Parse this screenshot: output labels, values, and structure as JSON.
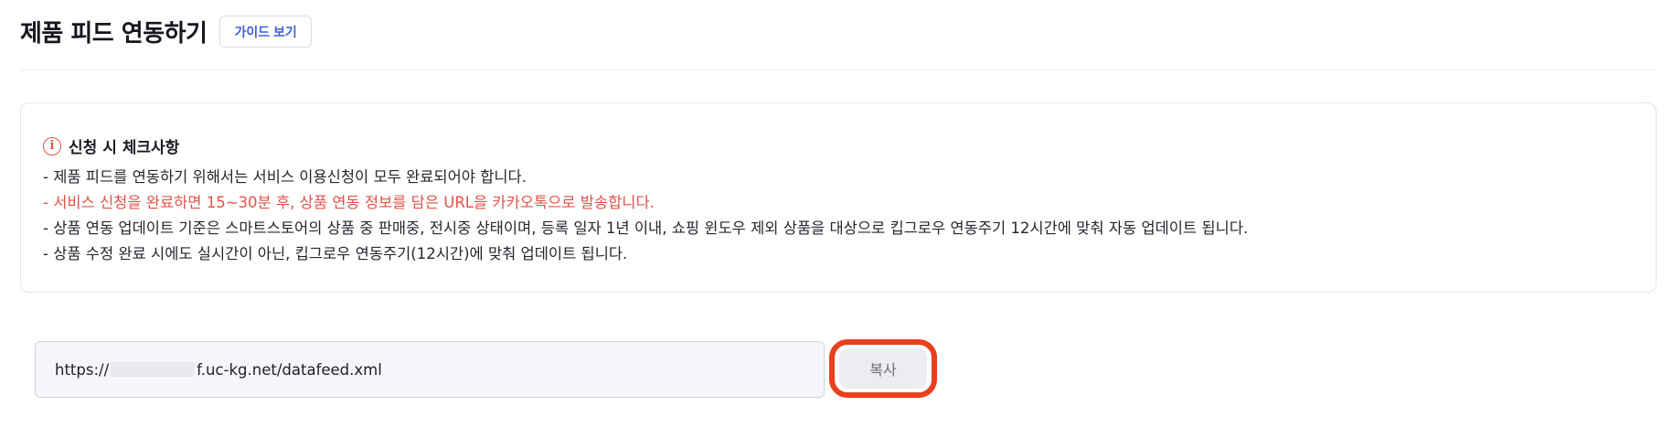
{
  "header": {
    "title": "제품 피드 연동하기",
    "guide_button": "가이드 보기"
  },
  "notice": {
    "icon": "info-circle-icon",
    "title": "신청 시 체크사항",
    "lines": [
      "- 제품 피드를 연동하기 위해서는 서비스 이용신청이 모두 완료되어야 합니다.",
      "- 서비스 신청을 완료하면 15~30분 후, 상품 연동 정보를 담은 URL을 카카오톡으로 발송합니다.",
      "- 상품 연동 업데이트 기준은 스마트스토어의 상품 중 판매중, 전시중 상태이며, 등록 일자 1년 이내, 쇼핑 윈도우 제외 상품을 대상으로 킵그로우 연동주기 12시간에 맞춰 자동 업데이트 됩니다.",
      "- 상품 수정 완료 시에도 실시간이 아닌, 킵그로우 연동주기(12시간)에 맞춰 업데이트 됩니다."
    ],
    "highlight_color": "#e0524a"
  },
  "feed_url": {
    "prefix": "https://",
    "suffix": "f.uc-kg.net/datafeed.xml"
  },
  "copy_button": "복사",
  "colors": {
    "accent": "#3f5fd6",
    "warning": "#e0524a",
    "highlight_frame": "#e8401f"
  }
}
